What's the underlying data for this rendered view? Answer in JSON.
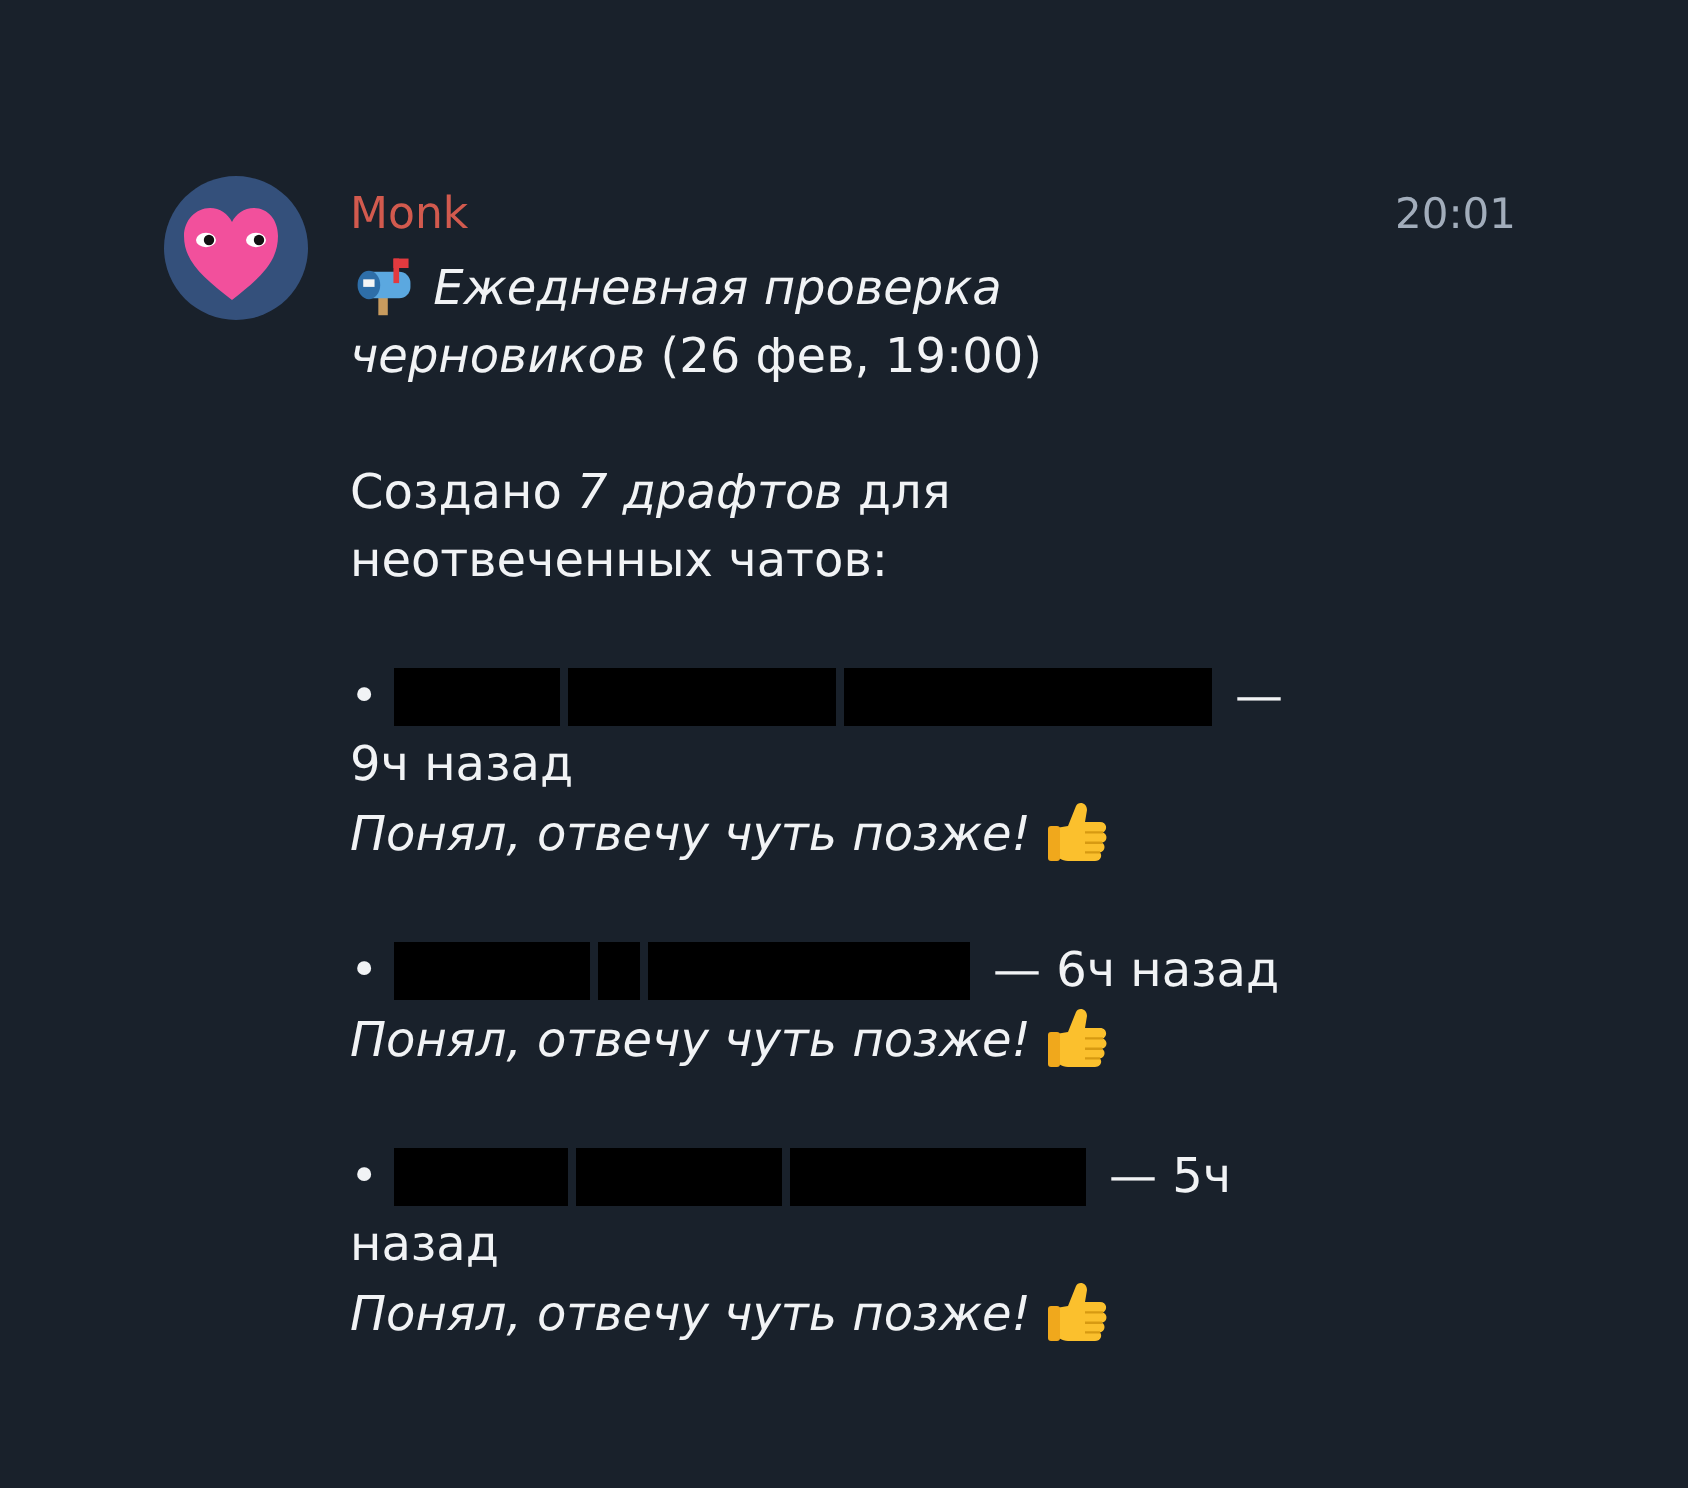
{
  "message": {
    "sender": "Monk",
    "time": "20:01",
    "title": "*Ежедневная проверка черновиков* (26 фев, 19:00)",
    "summary": "Создано *7 драфтов* для неотвеченных чатов:",
    "drafts": [
      {
        "bullet": "•",
        "name_parts": [
          {
            "kind": "redacted"
          },
          {
            "kind": "redacted"
          },
          {
            "kind": "redacted"
          }
        ],
        "age": "— 9ч назад",
        "reply": "Понял, отвечу чуть позже!"
      },
      {
        "bullet": "•",
        "name_parts": [
          {
            "kind": "redacted"
          },
          {
            "kind": "redacted"
          },
          {
            "kind": "redacted"
          }
        ],
        "age": "— 6ч назад",
        "reply": "Понял, отвечу чуть позже!"
      },
      {
        "bullet": "•",
        "name_parts": [
          {
            "kind": "redacted"
          },
          {
            "kind": "redacted"
          },
          {
            "kind": "redacted"
          }
        ],
        "age": "— 5ч назад",
        "reply": "Понял, отвечу чуть позже!"
      }
    ]
  }
}
